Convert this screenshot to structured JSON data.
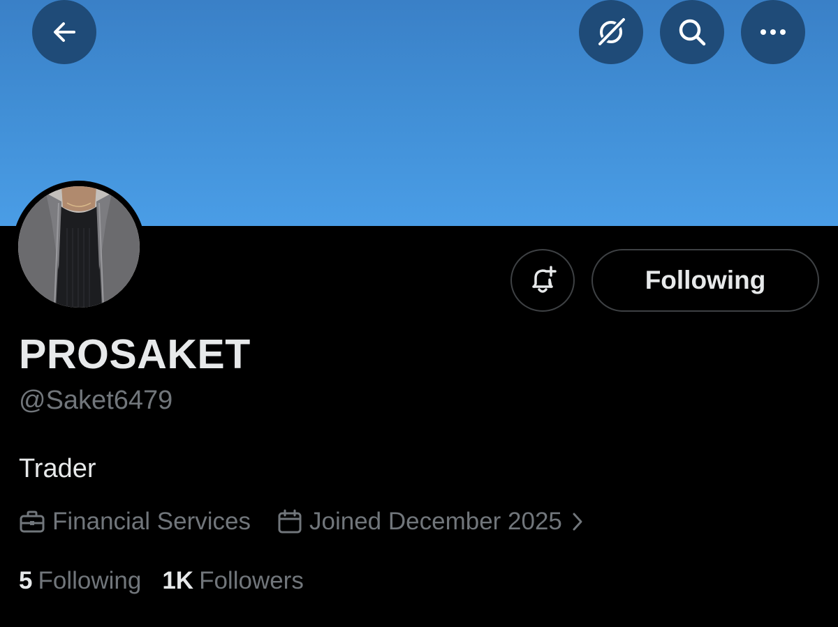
{
  "topbar": {
    "icons": [
      "back-arrow-icon",
      "grok-icon",
      "search-icon",
      "more-icon"
    ],
    "bg_color": "#1f4b78"
  },
  "banner": {
    "color": "#418fd6"
  },
  "profile": {
    "display_name": "PROSAKET",
    "handle": "@Saket6479",
    "bio": "Trader",
    "category": "Financial Services",
    "joined": "Joined December 2025",
    "following_count": "5",
    "following_label": "Following",
    "followers_count": "1K",
    "followers_label": "Followers"
  },
  "actions": {
    "notify_icon": "bell-plus-icon",
    "follow_button_label": "Following"
  },
  "colors": {
    "text_primary": "#e7e9ea",
    "text_secondary": "#71767b",
    "border": "#3e4144",
    "background": "#000000"
  }
}
